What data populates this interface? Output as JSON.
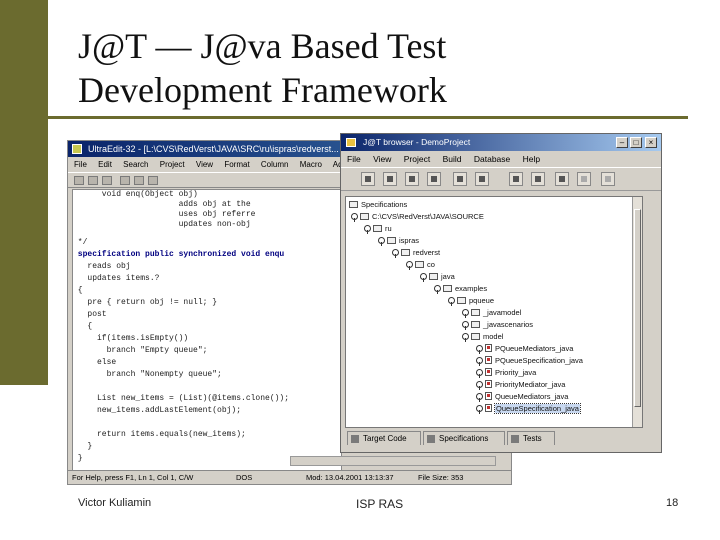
{
  "slide": {
    "title_line1": "J@T — J@va Based Test",
    "title_line2": "Development Framework",
    "footer_left": "Victor Kuliamin",
    "footer_center": "ISP RAS",
    "footer_right": "18",
    "accent_color": "#6b6b2f"
  },
  "ultraedit": {
    "title": "UltraEdit-32 - [L:\\CVS\\RedVerst\\JAVA\\SRC\\ru\\ispras\\redverst...",
    "menu": [
      "File",
      "Edit",
      "Search",
      "Project",
      "View",
      "Format",
      "Column",
      "Macro",
      "Adv"
    ],
    "code_lines": [
      "      void enq(Object obj)",
      "                       ",
      "                      adds obj at the",
      "                      uses obj referre",
      "                      updates non-obj",
      " */",
      " specification public synchronized void enqu",
      "   reads obj",
      "   updates items.?",
      " {",
      "   pre { return obj != null; }",
      "   post",
      "   {",
      "     if(items.isEmpty())",
      "       branch \"Empty queue\";",
      "     else",
      "       branch \"Nonempty queue\";",
      "",
      "     List new_items = (List)(@items.clone());",
      "     new_items.addLastElement(obj);",
      "",
      "     return items.equals(new_items);",
      "   }",
      " }"
    ],
    "status": {
      "help": "For Help, press F1, Ln 1, Col 1, C/W",
      "format": "DOS",
      "modified": "Mod: 13.04.2001 13:13:37",
      "file_size": "File Size: 353"
    }
  },
  "jat_browser": {
    "title": "J@T browser - DemoProject",
    "menu": [
      "File",
      "View",
      "Project",
      "Build",
      "Database",
      "Help"
    ],
    "tree": [
      {
        "label": "Specifications",
        "depth": 0,
        "kind": "folder"
      },
      {
        "label": "C:\\CVS\\RedVerst\\JAVA\\SOURCE",
        "depth": 1,
        "kind": "folder"
      },
      {
        "label": "ru",
        "depth": 2,
        "kind": "folder"
      },
      {
        "label": "ispras",
        "depth": 3,
        "kind": "folder"
      },
      {
        "label": "redverst",
        "depth": 4,
        "kind": "folder"
      },
      {
        "label": "co",
        "depth": 5,
        "kind": "folder"
      },
      {
        "label": "java",
        "depth": 6,
        "kind": "folder"
      },
      {
        "label": "examples",
        "depth": 7,
        "kind": "folder"
      },
      {
        "label": "pqueue",
        "depth": 8,
        "kind": "folder"
      },
      {
        "label": "_javamodel",
        "depth": 9,
        "kind": "folder"
      },
      {
        "label": "_javascenarios",
        "depth": 9,
        "kind": "folder"
      },
      {
        "label": "model",
        "depth": 9,
        "kind": "folder"
      },
      {
        "label": "PQueueMediators_java",
        "depth": 10,
        "kind": "leaf"
      },
      {
        "label": "PQueueSpecification_java",
        "depth": 10,
        "kind": "leaf"
      },
      {
        "label": "Priority_java",
        "depth": 10,
        "kind": "leaf"
      },
      {
        "label": "PriorityMediator_java",
        "depth": 10,
        "kind": "leaf"
      },
      {
        "label": "QueueMediators_java",
        "depth": 10,
        "kind": "leaf"
      },
      {
        "label": "QueueSpecification_java",
        "depth": 10,
        "kind": "leaf",
        "selected": true
      }
    ],
    "tabs": [
      "Target Code",
      "Specifications",
      "Tests"
    ]
  }
}
